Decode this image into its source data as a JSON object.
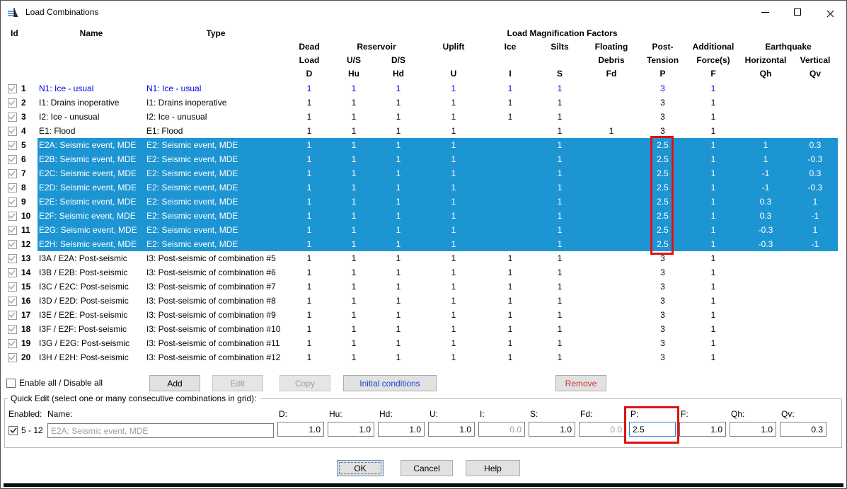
{
  "window": {
    "title": "Load Combinations"
  },
  "colors": {
    "selection_blue": "#1E95D3",
    "row_blue_text": "#0000E0",
    "link_blue": "#2144CC",
    "remove_red": "#D03434",
    "highlight_red": "#E01212"
  },
  "table": {
    "headers": {
      "id": "Id",
      "name": "Name",
      "type": "Type",
      "group": "Load Magnification Factors",
      "dead": [
        "Dead",
        "Load",
        "D"
      ],
      "reservoir": "Reservoir",
      "us": [
        "U/S",
        "Hu"
      ],
      "ds": [
        "D/S",
        "Hd"
      ],
      "uplift": [
        "Uplift",
        "U"
      ],
      "ice": [
        "Ice",
        "I"
      ],
      "silts": [
        "Silts",
        "S"
      ],
      "floating": [
        "Floating",
        "Debris",
        "Fd"
      ],
      "post": [
        "Post-",
        "Tension",
        "P"
      ],
      "additional": [
        "Additional",
        "Force(s)",
        "F"
      ],
      "earthquake": "Earthquake",
      "horizontal": [
        "Horizontal",
        "Qh"
      ],
      "vertical": [
        "Vertical",
        "Qv"
      ]
    },
    "rows": [
      {
        "id": "1",
        "name": "N1: Ice - usual",
        "type": "N1: Ice - usual",
        "d": "1",
        "hu": "1",
        "hd": "1",
        "u": "1",
        "i": "1",
        "s": "1",
        "fd": "",
        "p": "3",
        "f": "1",
        "qh": "",
        "qv": "",
        "blue": true,
        "selected": false
      },
      {
        "id": "2",
        "name": "I1: Drains inoperative",
        "type": "I1: Drains inoperative",
        "d": "1",
        "hu": "1",
        "hd": "1",
        "u": "1",
        "i": "1",
        "s": "1",
        "fd": "",
        "p": "3",
        "f": "1",
        "qh": "",
        "qv": "",
        "blue": false,
        "selected": false
      },
      {
        "id": "3",
        "name": "I2: Ice - unusual",
        "type": "I2: Ice - unusual",
        "d": "1",
        "hu": "1",
        "hd": "1",
        "u": "1",
        "i": "1",
        "s": "1",
        "fd": "",
        "p": "3",
        "f": "1",
        "qh": "",
        "qv": "",
        "blue": false,
        "selected": false
      },
      {
        "id": "4",
        "name": "E1: Flood",
        "type": "E1: Flood",
        "d": "1",
        "hu": "1",
        "hd": "1",
        "u": "1",
        "i": "",
        "s": "1",
        "fd": "1",
        "p": "3",
        "f": "1",
        "qh": "",
        "qv": "",
        "blue": false,
        "selected": false
      },
      {
        "id": "5",
        "name": "E2A: Seismic event, MDE",
        "type": "E2: Seismic event, MDE",
        "d": "1",
        "hu": "1",
        "hd": "1",
        "u": "1",
        "i": "",
        "s": "1",
        "fd": "",
        "p": "2.5",
        "f": "1",
        "qh": "1",
        "qv": "0.3",
        "blue": false,
        "selected": true
      },
      {
        "id": "6",
        "name": "E2B: Seismic event, MDE",
        "type": "E2: Seismic event, MDE",
        "d": "1",
        "hu": "1",
        "hd": "1",
        "u": "1",
        "i": "",
        "s": "1",
        "fd": "",
        "p": "2.5",
        "f": "1",
        "qh": "1",
        "qv": "-0.3",
        "blue": false,
        "selected": true
      },
      {
        "id": "7",
        "name": "E2C: Seismic event, MDE",
        "type": "E2: Seismic event, MDE",
        "d": "1",
        "hu": "1",
        "hd": "1",
        "u": "1",
        "i": "",
        "s": "1",
        "fd": "",
        "p": "2.5",
        "f": "1",
        "qh": "-1",
        "qv": "0.3",
        "blue": false,
        "selected": true
      },
      {
        "id": "8",
        "name": "E2D: Seismic event, MDE",
        "type": "E2: Seismic event, MDE",
        "d": "1",
        "hu": "1",
        "hd": "1",
        "u": "1",
        "i": "",
        "s": "1",
        "fd": "",
        "p": "2.5",
        "f": "1",
        "qh": "-1",
        "qv": "-0.3",
        "blue": false,
        "selected": true
      },
      {
        "id": "9",
        "name": "E2E: Seismic event, MDE",
        "type": "E2: Seismic event, MDE",
        "d": "1",
        "hu": "1",
        "hd": "1",
        "u": "1",
        "i": "",
        "s": "1",
        "fd": "",
        "p": "2.5",
        "f": "1",
        "qh": "0.3",
        "qv": "1",
        "blue": false,
        "selected": true
      },
      {
        "id": "10",
        "name": "E2F: Seismic event, MDE",
        "type": "E2: Seismic event, MDE",
        "d": "1",
        "hu": "1",
        "hd": "1",
        "u": "1",
        "i": "",
        "s": "1",
        "fd": "",
        "p": "2.5",
        "f": "1",
        "qh": "0.3",
        "qv": "-1",
        "blue": false,
        "selected": true
      },
      {
        "id": "11",
        "name": "E2G: Seismic event, MDE",
        "type": "E2: Seismic event, MDE",
        "d": "1",
        "hu": "1",
        "hd": "1",
        "u": "1",
        "i": "",
        "s": "1",
        "fd": "",
        "p": "2.5",
        "f": "1",
        "qh": "-0.3",
        "qv": "1",
        "blue": false,
        "selected": true
      },
      {
        "id": "12",
        "name": "E2H: Seismic event, MDE",
        "type": "E2: Seismic event, MDE",
        "d": "1",
        "hu": "1",
        "hd": "1",
        "u": "1",
        "i": "",
        "s": "1",
        "fd": "",
        "p": "2.5",
        "f": "1",
        "qh": "-0.3",
        "qv": "-1",
        "blue": false,
        "selected": true
      },
      {
        "id": "13",
        "name": "I3A / E2A: Post-seismic",
        "type": "I3: Post-seismic of combination #5",
        "d": "1",
        "hu": "1",
        "hd": "1",
        "u": "1",
        "i": "1",
        "s": "1",
        "fd": "",
        "p": "3",
        "f": "1",
        "qh": "",
        "qv": "",
        "blue": false,
        "selected": false
      },
      {
        "id": "14",
        "name": "I3B / E2B: Post-seismic",
        "type": "I3: Post-seismic of combination #6",
        "d": "1",
        "hu": "1",
        "hd": "1",
        "u": "1",
        "i": "1",
        "s": "1",
        "fd": "",
        "p": "3",
        "f": "1",
        "qh": "",
        "qv": "",
        "blue": false,
        "selected": false
      },
      {
        "id": "15",
        "name": "I3C / E2C: Post-seismic",
        "type": "I3: Post-seismic of combination #7",
        "d": "1",
        "hu": "1",
        "hd": "1",
        "u": "1",
        "i": "1",
        "s": "1",
        "fd": "",
        "p": "3",
        "f": "1",
        "qh": "",
        "qv": "",
        "blue": false,
        "selected": false
      },
      {
        "id": "16",
        "name": "I3D / E2D: Post-seismic",
        "type": "I3: Post-seismic of combination #8",
        "d": "1",
        "hu": "1",
        "hd": "1",
        "u": "1",
        "i": "1",
        "s": "1",
        "fd": "",
        "p": "3",
        "f": "1",
        "qh": "",
        "qv": "",
        "blue": false,
        "selected": false
      },
      {
        "id": "17",
        "name": "I3E / E2E: Post-seismic",
        "type": "I3: Post-seismic of combination #9",
        "d": "1",
        "hu": "1",
        "hd": "1",
        "u": "1",
        "i": "1",
        "s": "1",
        "fd": "",
        "p": "3",
        "f": "1",
        "qh": "",
        "qv": "",
        "blue": false,
        "selected": false
      },
      {
        "id": "18",
        "name": "I3F / E2F: Post-seismic",
        "type": "I3: Post-seismic of combination #10",
        "d": "1",
        "hu": "1",
        "hd": "1",
        "u": "1",
        "i": "1",
        "s": "1",
        "fd": "",
        "p": "3",
        "f": "1",
        "qh": "",
        "qv": "",
        "blue": false,
        "selected": false
      },
      {
        "id": "19",
        "name": "I3G / E2G: Post-seismic",
        "type": "I3: Post-seismic of combination #11",
        "d": "1",
        "hu": "1",
        "hd": "1",
        "u": "1",
        "i": "1",
        "s": "1",
        "fd": "",
        "p": "3",
        "f": "1",
        "qh": "",
        "qv": "",
        "blue": false,
        "selected": false
      },
      {
        "id": "20",
        "name": "I3H / E2H: Post-seismic",
        "type": "I3: Post-seismic of combination #12",
        "d": "1",
        "hu": "1",
        "hd": "1",
        "u": "1",
        "i": "1",
        "s": "1",
        "fd": "",
        "p": "3",
        "f": "1",
        "qh": "",
        "qv": "",
        "blue": false,
        "selected": false
      }
    ]
  },
  "actions": {
    "enable_all": "Enable all / Disable all",
    "add": "Add",
    "edit": "Edit",
    "copy": "Copy",
    "initial_conditions": "Initial conditions",
    "remove": "Remove"
  },
  "quick_edit": {
    "title": "Quick Edit (select one or many consecutive combinations in grid):",
    "enabled_label": "Enabled:",
    "name_label": "Name:",
    "range": "5 - 12",
    "name_value": "E2A: Seismic event, MDE",
    "fields": [
      {
        "label": "D:",
        "value": "1.0",
        "disabled": false,
        "editing": false
      },
      {
        "label": "Hu:",
        "value": "1.0",
        "disabled": false,
        "editing": false
      },
      {
        "label": "Hd:",
        "value": "1.0",
        "disabled": false,
        "editing": false
      },
      {
        "label": "U:",
        "value": "1.0",
        "disabled": false,
        "editing": false
      },
      {
        "label": "I:",
        "value": "0.0",
        "disabled": true,
        "editing": false
      },
      {
        "label": "S:",
        "value": "1.0",
        "disabled": false,
        "editing": false
      },
      {
        "label": "Fd:",
        "value": "0.0",
        "disabled": true,
        "editing": false
      },
      {
        "label": "P:",
        "value": "2.5",
        "disabled": false,
        "editing": true
      },
      {
        "label": "F:",
        "value": "1.0",
        "disabled": false,
        "editing": false
      },
      {
        "label": "Qh:",
        "value": "1.0",
        "disabled": false,
        "editing": false
      },
      {
        "label": "Qv:",
        "value": "0.3",
        "disabled": false,
        "editing": false
      }
    ]
  },
  "footer": {
    "ok": "OK",
    "cancel": "Cancel",
    "help": "Help"
  }
}
